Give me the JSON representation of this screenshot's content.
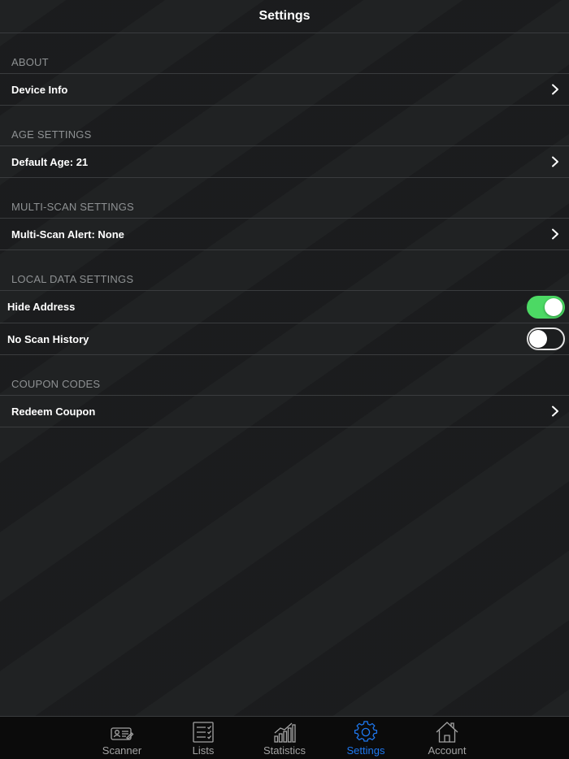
{
  "navbar": {
    "title": "Settings"
  },
  "sections": [
    {
      "header": "ABOUT",
      "rows": [
        {
          "label": "Device Info"
        }
      ]
    },
    {
      "header": "AGE SETTINGS",
      "rows": [
        {
          "label": "Default Age: 21"
        }
      ]
    },
    {
      "header": "MULTI-SCAN SETTINGS",
      "rows": [
        {
          "label": "Multi-Scan Alert: None"
        }
      ]
    },
    {
      "header": "LOCAL DATA SETTINGS",
      "rows": [
        {
          "label": "Hide Address",
          "toggle": true
        },
        {
          "label": "No Scan History",
          "toggle": false
        }
      ]
    },
    {
      "header": "COUPON CODES",
      "rows": [
        {
          "label": "Redeem Coupon"
        }
      ]
    }
  ],
  "tabbar": {
    "active": "Settings",
    "tabs": [
      {
        "label": "Scanner",
        "icon": "scanner-id-card-icon"
      },
      {
        "label": "Lists",
        "icon": "list-icon"
      },
      {
        "label": "Statistics",
        "icon": "bar-chart-icon"
      },
      {
        "label": "Settings",
        "icon": "gear-icon"
      },
      {
        "label": "Account",
        "icon": "home-icon"
      }
    ]
  },
  "colors": {
    "background": "#1c1e1f",
    "toggle_on": "#4cd964",
    "active_tab": "#1e78f0",
    "section_header": "#8e9193"
  }
}
